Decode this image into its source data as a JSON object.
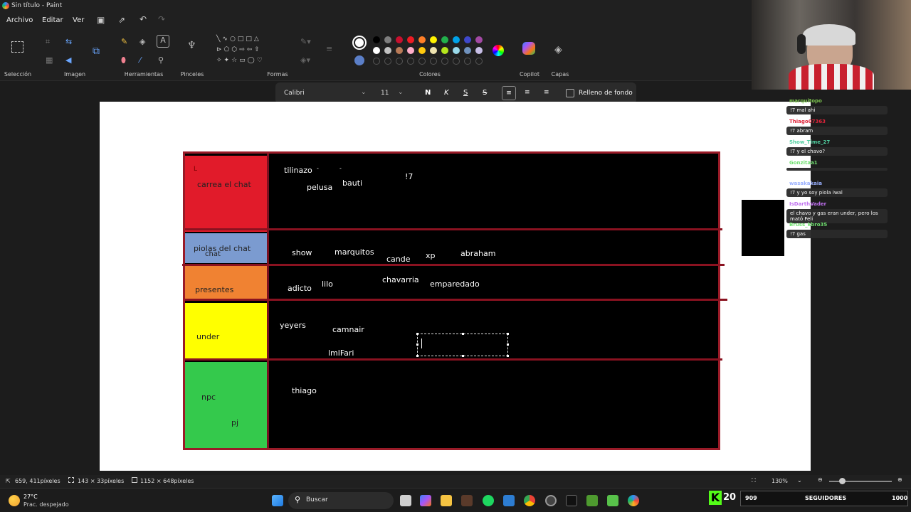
{
  "window": {
    "title": "Sin título - Paint"
  },
  "menu": {
    "items": [
      "Archivo",
      "Editar",
      "Ver"
    ]
  },
  "ribbon": {
    "groups": [
      "Selección",
      "Imagen",
      "Herramientas",
      "Pinceles",
      "Formas",
      "Colores",
      "Copilot",
      "Capas"
    ]
  },
  "colors": {
    "row1": [
      "#000000",
      "#7f7f7f",
      "#c8102e",
      "#ed1c24",
      "#ff7f27",
      "#fff200",
      "#22b14c",
      "#00a2e8",
      "#3f48cc",
      "#a349a4"
    ],
    "row2": [
      "#ffffff",
      "#c3c3c3",
      "#b97a57",
      "#ffaec9",
      "#ffc90e",
      "#efe4b0",
      "#b5e61d",
      "#99d9ea",
      "#7092be",
      "#c8bfe7"
    ],
    "primary": "#ffffff",
    "secondary": "#5b7fc8"
  },
  "textbar": {
    "font": "Calibri",
    "size": "11",
    "bold": "N",
    "italic": "K",
    "underline": "S",
    "strike": "S",
    "fill_label": "Relleno de fondo"
  },
  "tiers": [
    {
      "label": "carrea el chat",
      "color": "#e11b2a",
      "names": [
        "tilinazo",
        "pelusa",
        "bauti",
        "!7",
        "-",
        "-"
      ]
    },
    {
      "label": "piolas del chat",
      "label2": "chat",
      "color": "#7b9bd0",
      "names": [
        "show",
        "marquitos",
        "cande",
        "xp",
        "abraham"
      ]
    },
    {
      "label": "presentes",
      "color": "#f08232",
      "names": [
        "adicto",
        "lilo",
        "chavarria",
        "emparedado"
      ]
    },
    {
      "label": "under",
      "color": "#ffff00",
      "names": [
        "yeyers",
        "camnair",
        "lmlFari"
      ]
    },
    {
      "label": "npc",
      "label2": "pj",
      "color": "#34c94c",
      "names": [
        "thiago"
      ]
    }
  ],
  "status": {
    "cursor": "659, 411píxeles",
    "selection": "143 × 33píxeles",
    "canvas_size": "1152 × 648píxeles",
    "zoom": "130%"
  },
  "weather": {
    "temp": "27°C",
    "desc": "Prac. despejado"
  },
  "taskbar": {
    "search_placeholder": "Buscar"
  },
  "chat": [
    {
      "user": "marquitopo",
      "color": "#7ec850",
      "msg": "!7 mal ahi"
    },
    {
      "user": "Thiago07363",
      "color": "#e0243a",
      "msg": "!7 abram"
    },
    {
      "user": "Show_Time_27",
      "color": "#50d0a0",
      "msg": "!7 y el chavo?"
    },
    {
      "user": "Gonzitaa1",
      "color": "#70e070",
      "msg": ""
    },
    {
      "user": "wasakakaia",
      "color": "#9ab0ff",
      "msg": "!7 y yo soy piola iwal"
    },
    {
      "user": "IsDarthVader",
      "color": "#c070f0",
      "msg": "el chavo y gas eran under, pero los mató Feli"
    },
    {
      "user": "Bruss_kbro35",
      "color": "#70e070",
      "msg": "!7 gas"
    }
  ],
  "kick": {
    "logo": "K",
    "number": "20",
    "followers": "909",
    "label": "SEGUIDORES",
    "goal": "1000"
  }
}
